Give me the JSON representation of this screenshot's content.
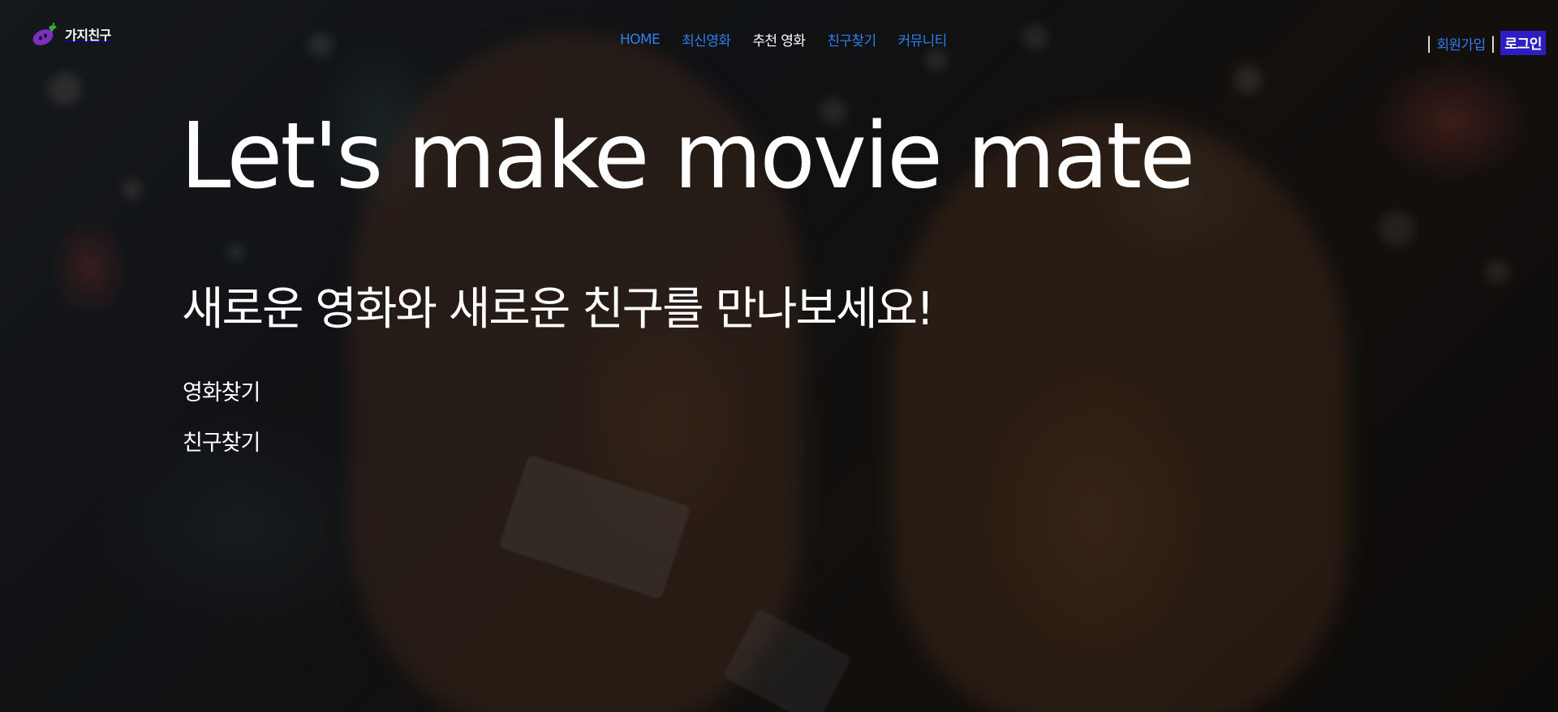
{
  "brand": {
    "name": "가지친구",
    "logo_icon": "eggplant-icon",
    "logo_colors": {
      "body": "#7b2fbe",
      "leaf": "#3aa93a"
    }
  },
  "nav": {
    "items": [
      {
        "label": "HOME",
        "active": false
      },
      {
        "label": "최신영화",
        "active": false
      },
      {
        "label": "추천 영화",
        "active": true
      },
      {
        "label": "친구찾기",
        "active": false
      },
      {
        "label": "커뮤니티",
        "active": false
      }
    ]
  },
  "auth": {
    "signup_label": "회원가입",
    "login_label": "로그인",
    "separator": "|"
  },
  "hero": {
    "headline": "Let's make movie mate",
    "subheadline": "새로운 영화와 새로운 친구를 만나보세요!",
    "links": [
      "영화찾기",
      "친구찾기"
    ]
  },
  "colors": {
    "link": "#2f7ef0",
    "text": "#ffffff",
    "login_bg": "#2d1ec2"
  }
}
